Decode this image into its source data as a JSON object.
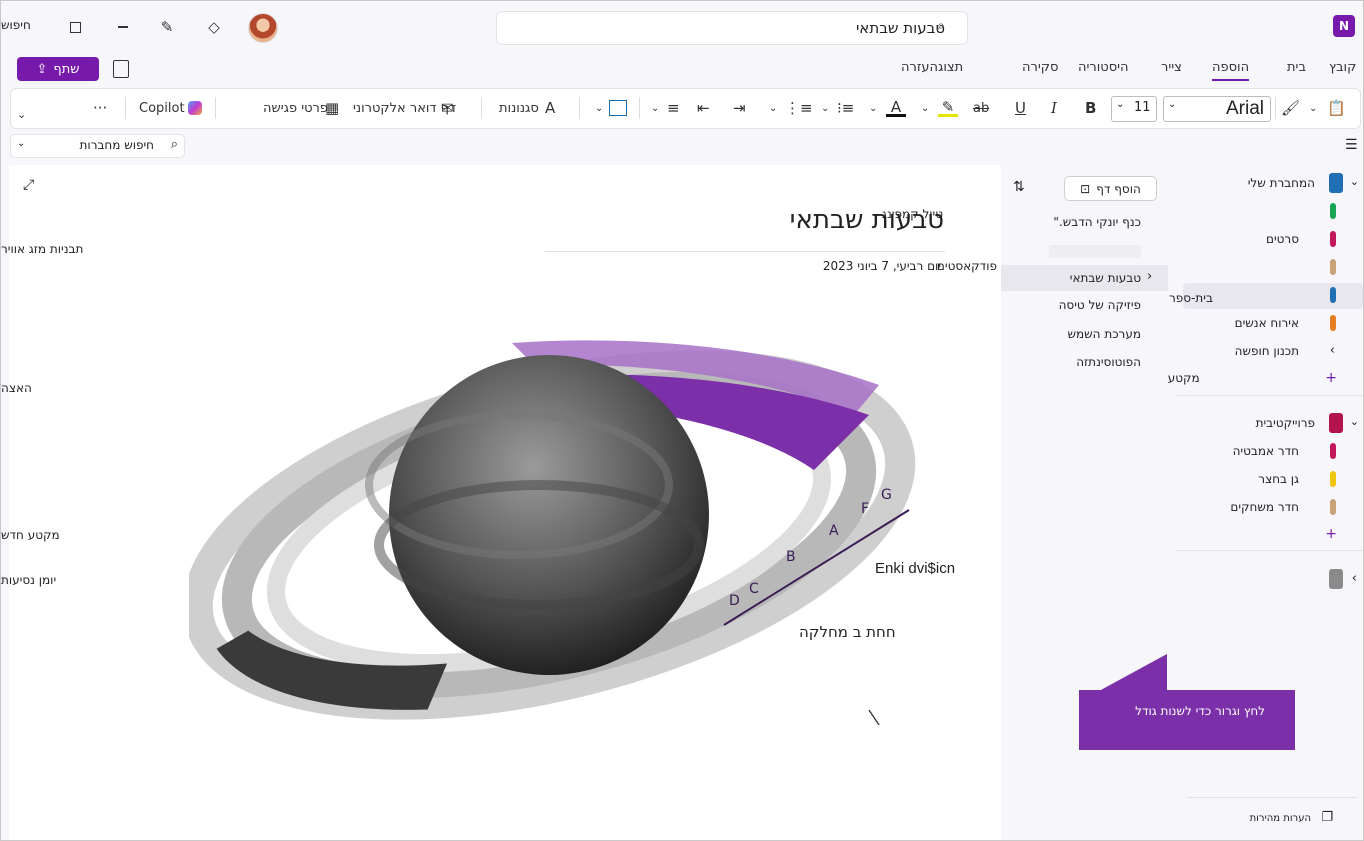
{
  "titlebar": {
    "search_text": "טבעות שבתאי",
    "app_icon_label": "N",
    "search_label": "חיפוש"
  },
  "tabs": [
    {
      "label": "קובץ"
    },
    {
      "label": "בית"
    },
    {
      "label": "הוספה"
    },
    {
      "label": "צייר"
    },
    {
      "label": "היסטוריה"
    },
    {
      "label": "סקירה"
    },
    {
      "label": "תצוגהעזרה"
    }
  ],
  "share": {
    "label": "שתף"
  },
  "ribbon": {
    "font_name": "Arial",
    "font_size": "11",
    "styles_label": "סגנונות",
    "email_label": "דף דואר אלקטרוני",
    "meeting_label": "פרטי פגישה",
    "copilot_label": "Copilot",
    "more": "···"
  },
  "notebook_search": {
    "label": "חיפוש מחברות"
  },
  "notebooks": [
    {
      "name": "המחברת שלי",
      "color": "#1f6fb5"
    },
    {
      "name": "פרוייקטיבית",
      "color": "#b4144c"
    },
    {
      "name": "",
      "color": "#8a8a8a"
    }
  ],
  "sections": [
    {
      "name": "",
      "color": "#19a354"
    },
    {
      "name": "סרטים",
      "color": "#c2185b"
    },
    {
      "name": "",
      "color": "#c9a27a"
    },
    {
      "name": "בית-ספר",
      "color": "#1f6fb5"
    },
    {
      "name": "אירוח אנשים",
      "color": "#e67e22"
    },
    {
      "name": "תכנון חופשה",
      "color": ""
    },
    {
      "name": "מקטע חדש",
      "color": ""
    }
  ],
  "sections2": [
    {
      "name": "חדר אמבטיה",
      "color": "#c2185b"
    },
    {
      "name": "גן בחצר",
      "color": "#f1c40f"
    },
    {
      "name": "חדר משחקים",
      "color": "#c9a27a"
    }
  ],
  "quick_notes": {
    "label": "הערות מהירות"
  },
  "pages": {
    "add_label": "הוסף דף",
    "items": [
      {
        "title": "כנף יונקי הדבש.\""
      },
      {
        "title": ""
      },
      {
        "title": "טבעות שבתאי"
      },
      {
        "title": "פיזיקה של טיסה"
      },
      {
        "title": "מערכת השמש"
      },
      {
        "title": "הפוטוסינתזה"
      }
    ]
  },
  "left_fragments": {
    "a": "תבניות מזג אוויר",
    "b": "האצה",
    "c": "מקטע חדש",
    "d": "יומן נסיעות",
    "e": "טיול קמפינג",
    "f": "פודקאסטים"
  },
  "page": {
    "title": "טבעות שבתאי",
    "date": "יום רביעי, 7 ביוני 2023",
    "labels": {
      "ring_a": "A",
      "ring_b": "B",
      "ring_c": "C",
      "ring_d": "D",
      "ring_f": "F",
      "ring_g": "G",
      "enki": "Enki dvi$icn",
      "chach": "חחת ב מחלקה"
    }
  },
  "tooltip": {
    "text": "לחץ וגרור כדי לשנות גודל"
  },
  "colors": {
    "accent": "#7719aa",
    "ring_purple": "#7b2fa8"
  }
}
